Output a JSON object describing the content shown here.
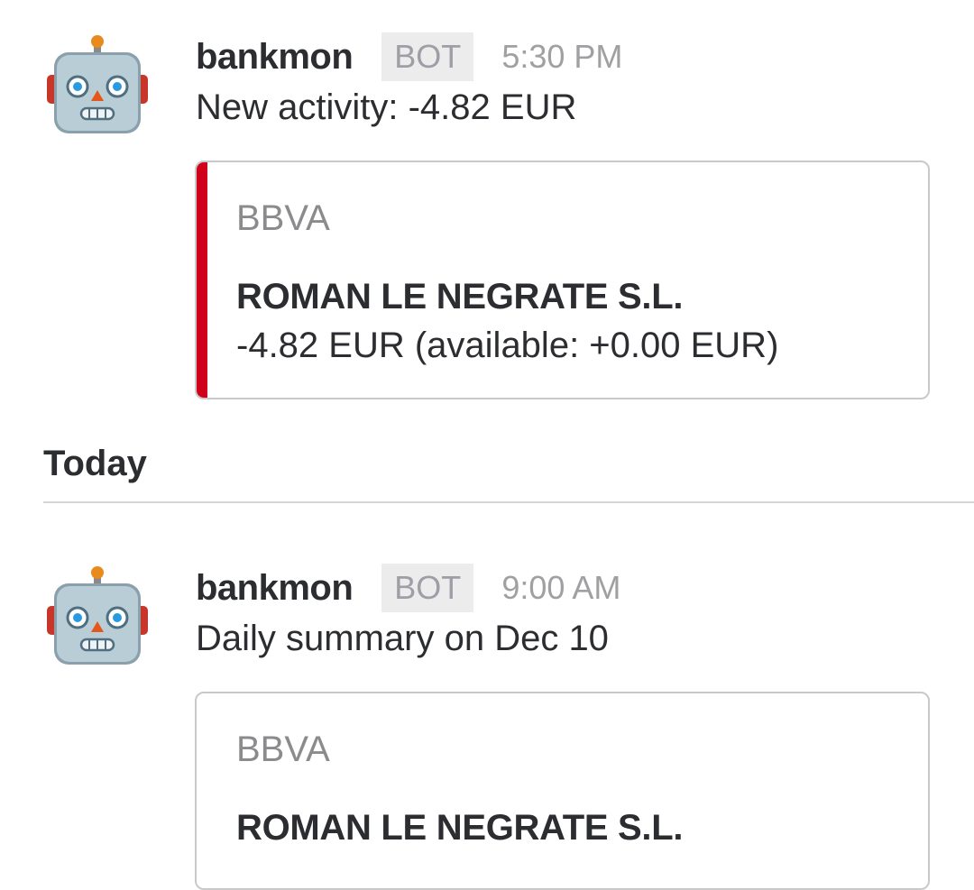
{
  "messages": [
    {
      "sender": "bankmon",
      "badge": "BOT",
      "time": "5:30 PM",
      "text": "New activity: -4.82 EUR",
      "attachment": {
        "color": "#d0021b",
        "service": "BBVA",
        "title": "ROMAN LE NEGRATE S.L.",
        "body": "-4.82 EUR (available: +0.00 EUR)"
      }
    },
    {
      "sender": "bankmon",
      "badge": "BOT",
      "time": "9:00 AM",
      "text": "Daily summary on Dec 10",
      "attachment": {
        "service": "BBVA",
        "title": "ROMAN LE NEGRATE S.L."
      }
    }
  ],
  "divider": {
    "label": "Today"
  },
  "avatar_icon": "robot-face-icon"
}
